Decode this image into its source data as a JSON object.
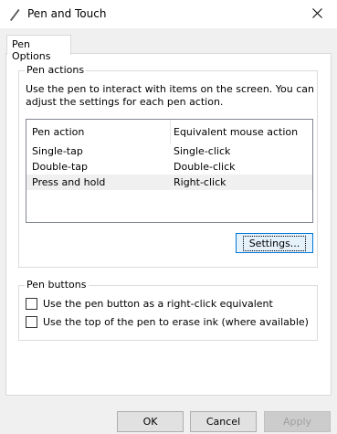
{
  "window": {
    "title": "Pen and Touch"
  },
  "tabs": [
    {
      "label": "Pen Options"
    }
  ],
  "pen_actions": {
    "group_label": "Pen actions",
    "description": "Use the pen to interact with items on the screen.  You can adjust the settings for each pen action.",
    "columns": [
      "Pen action",
      "Equivalent mouse action"
    ],
    "rows": [
      {
        "action": "Single-tap",
        "mouse": "Single-click"
      },
      {
        "action": "Double-tap",
        "mouse": "Double-click"
      },
      {
        "action": "Press and hold",
        "mouse": "Right-click"
      }
    ],
    "settings_label": "Settings..."
  },
  "pen_buttons": {
    "group_label": "Pen buttons",
    "options": [
      {
        "label": "Use the pen button as a right-click equivalent",
        "checked": false
      },
      {
        "label": "Use the top of the pen to erase ink (where available)",
        "checked": false
      }
    ]
  },
  "footer": {
    "ok": "OK",
    "cancel": "Cancel",
    "apply": "Apply"
  }
}
